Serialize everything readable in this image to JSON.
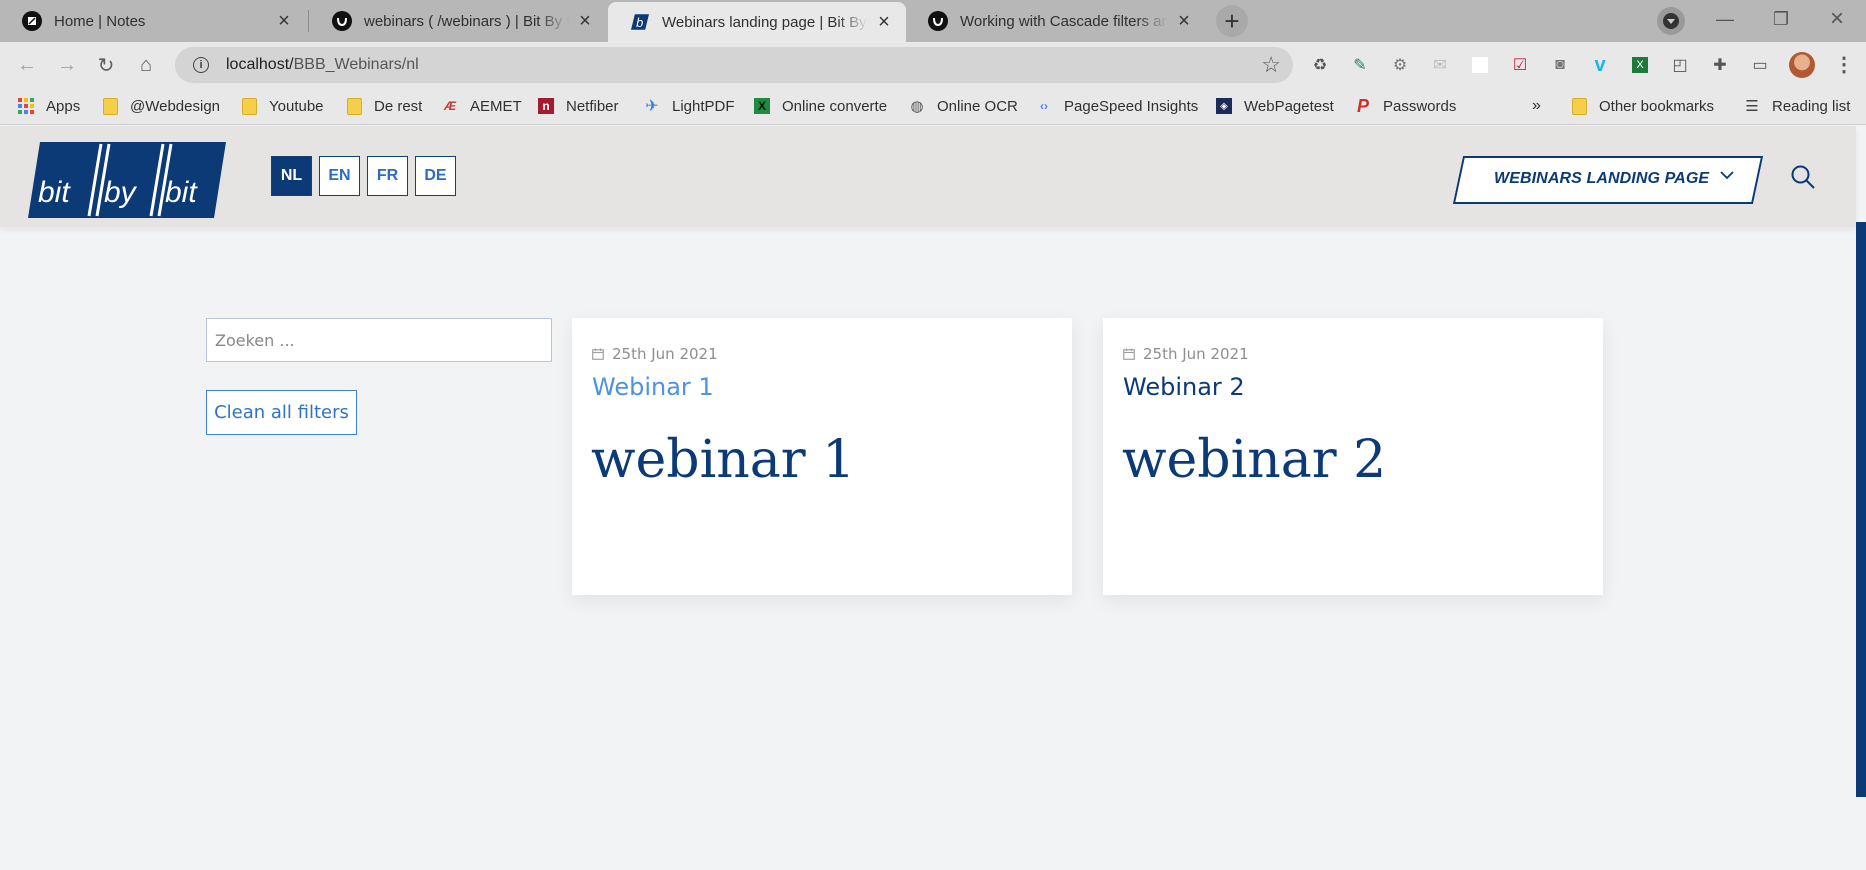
{
  "browser": {
    "tabs": [
      {
        "title": "Home | Notes",
        "icon": "notes-favicon"
      },
      {
        "title": "webinars ( /webinars ) | Bit By Bit",
        "icon": "umbraco-favicon"
      },
      {
        "title": "Webinars landing page | Bit By Bit",
        "icon": "bitbybit-favicon",
        "active": true
      },
      {
        "title": "Working with Cascade filters and",
        "icon": "umbraco-favicon"
      }
    ],
    "url_host": "localhost/",
    "url_path": "BBB_Webinars/nl",
    "bookmarks": [
      {
        "label": "Apps",
        "icon": "apps-grid-icon"
      },
      {
        "label": "@Webdesign",
        "icon": "folder-icon"
      },
      {
        "label": "Youtube",
        "icon": "folder-icon"
      },
      {
        "label": "De rest",
        "icon": "folder-icon"
      },
      {
        "label": "AEMET",
        "icon": "aemet-icon"
      },
      {
        "label": "Netfiber",
        "icon": "netfiber-icon"
      },
      {
        "label": "LightPDF",
        "icon": "lightpdf-icon"
      },
      {
        "label": "Online converte",
        "icon": "converter-icon"
      },
      {
        "label": "Online OCR",
        "icon": "globe-icon"
      },
      {
        "label": "PageSpeed Insights",
        "icon": "pagespeed-icon"
      },
      {
        "label": "WebPagetest",
        "icon": "webpagetest-icon"
      },
      {
        "label": "Passwords",
        "icon": "lastpass-icon"
      }
    ],
    "overflow_label": "»",
    "other_bookmarks": "Other bookmarks",
    "reading_list": "Reading list"
  },
  "site": {
    "logo_text": "bit by bit",
    "languages": [
      {
        "code": "NL",
        "active": true
      },
      {
        "code": "EN",
        "active": false
      },
      {
        "code": "FR",
        "active": false
      },
      {
        "code": "DE",
        "active": false
      }
    ],
    "page_selector": "WEBINARS LANDING PAGE"
  },
  "filters": {
    "search_placeholder": "Zoeken ...",
    "clean_label": "Clean all filters"
  },
  "cards": [
    {
      "date": "25th Jun 2021",
      "title": "Webinar 1",
      "body": "webinar 1"
    },
    {
      "date": "25th Jun 2021",
      "title": "Webinar 2",
      "body": "webinar 2"
    }
  ],
  "colors": {
    "brand_navy": "#0b3a76",
    "link_blue": "#2f73c7",
    "hover_blue": "#4e92e4"
  }
}
